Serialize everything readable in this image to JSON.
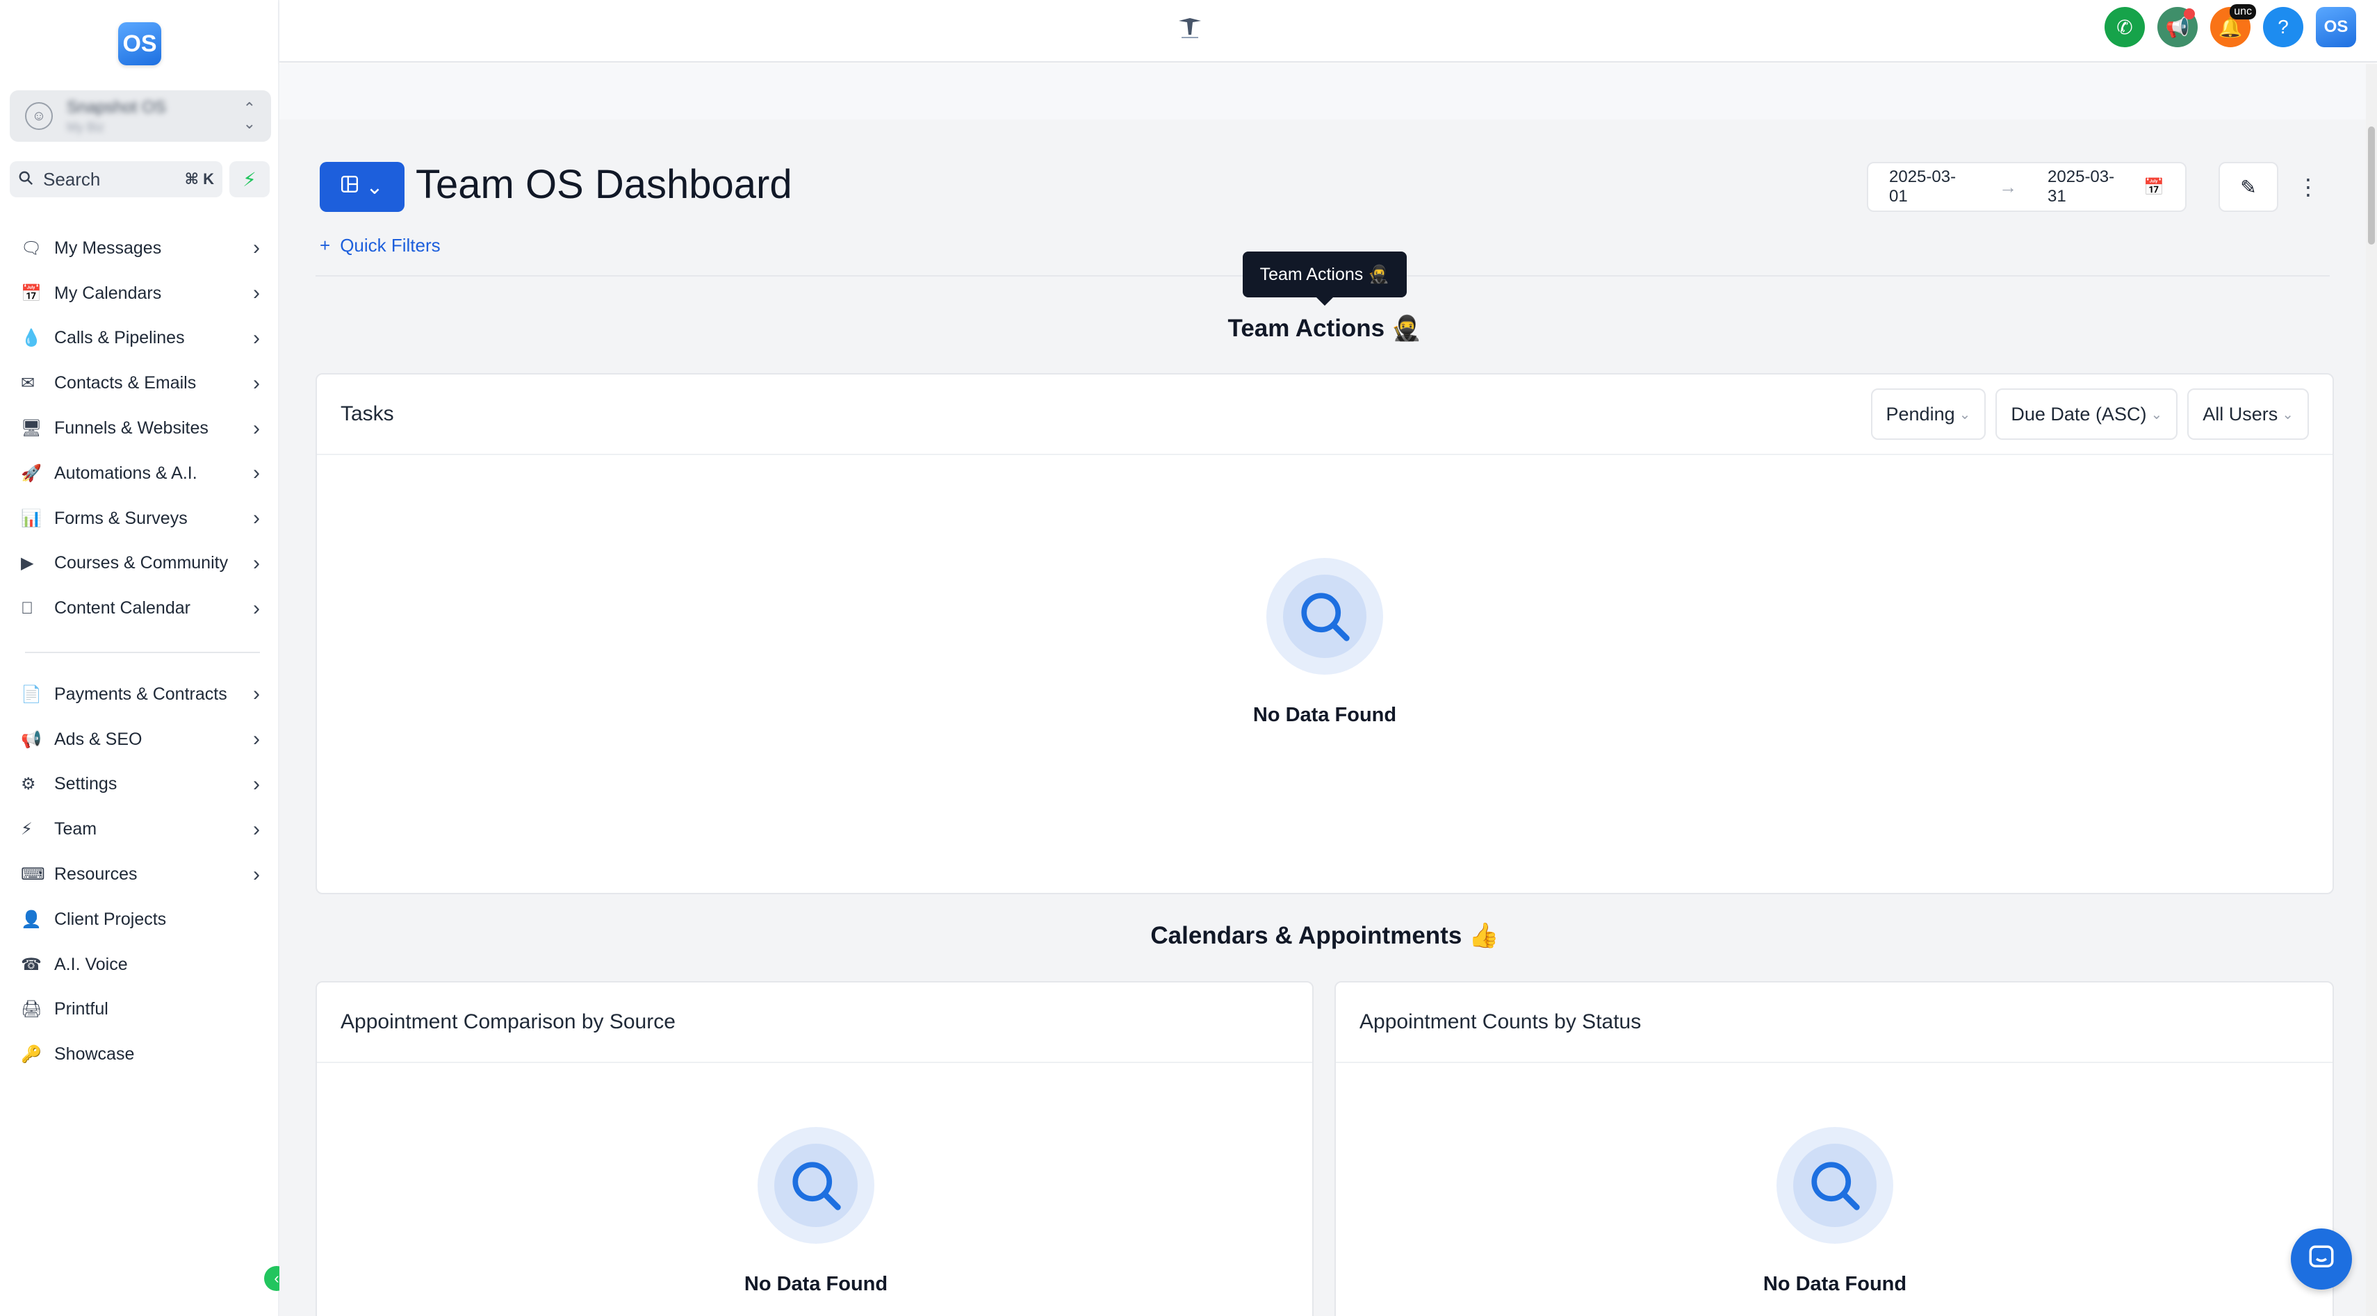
{
  "app": {
    "logo_text": "OS",
    "account": {
      "name": "Snapshot OS",
      "sub": "My Biz"
    }
  },
  "sidebar": {
    "search_label": "Search",
    "search_shortcut": "⌘ K",
    "items_primary": [
      {
        "label": "My Messages",
        "icon": "chat-icon",
        "has_chevron": true
      },
      {
        "label": "My Calendars",
        "icon": "calendar-icon",
        "has_chevron": true
      },
      {
        "label": "Calls & Pipelines",
        "icon": "drop-icon",
        "has_chevron": true
      },
      {
        "label": "Contacts & Emails",
        "icon": "mail-icon",
        "has_chevron": true
      },
      {
        "label": "Funnels & Websites",
        "icon": "monitor-icon",
        "has_chevron": true
      },
      {
        "label": "Automations & A.I.",
        "icon": "rocket-icon",
        "has_chevron": true
      },
      {
        "label": "Forms & Surveys",
        "icon": "chart-icon",
        "has_chevron": true
      },
      {
        "label": "Courses & Community",
        "icon": "video-icon",
        "has_chevron": true
      },
      {
        "label": "Content Calendar",
        "icon": "apple-icon",
        "has_chevron": true
      }
    ],
    "items_secondary": [
      {
        "label": "Payments & Contracts",
        "icon": "invoice-icon",
        "has_chevron": true
      },
      {
        "label": "Ads & SEO",
        "icon": "ad-icon",
        "has_chevron": true
      },
      {
        "label": "Settings",
        "icon": "gear-icon",
        "has_chevron": true
      },
      {
        "label": "Team",
        "icon": "bolt-icon",
        "has_chevron": true
      },
      {
        "label": "Resources",
        "icon": "keyboard-icon",
        "has_chevron": true
      },
      {
        "label": "Client Projects",
        "icon": "user-icon",
        "has_chevron": false
      },
      {
        "label": "A.I. Voice",
        "icon": "phone-icon",
        "has_chevron": false
      },
      {
        "label": "Printful",
        "icon": "printer-icon",
        "has_chevron": false
      },
      {
        "label": "Showcase",
        "icon": "key-icon",
        "has_chevron": false
      }
    ]
  },
  "topbar": {
    "notification_badge": "unc"
  },
  "dashboard": {
    "title": "Team OS Dashboard",
    "quick_filters": "Quick Filters",
    "date_from": "2025-03-01",
    "date_to": "2025-03-31",
    "tooltip": "Team Actions 🥷",
    "section_team_actions": "Team Actions 🥷",
    "section_calendars": "Calendars & Appointments 👍",
    "tasks_card": {
      "title": "Tasks",
      "filter_status": "Pending",
      "filter_sort": "Due Date (ASC)",
      "filter_users": "All Users",
      "empty_text": "No Data Found"
    },
    "appt_source_card": {
      "title": "Appointment Comparison by Source",
      "empty_text": "No Data Found"
    },
    "appt_status_card": {
      "title": "Appointment Counts by Status",
      "empty_text": "No Data Found"
    }
  },
  "colors": {
    "primary": "#1d5fdc",
    "call_green": "#16a34a",
    "announce_green": "#3f8f6a",
    "bell_orange": "#f97316",
    "help_blue": "#1d8cf0",
    "accent_green": "#22c55e"
  }
}
